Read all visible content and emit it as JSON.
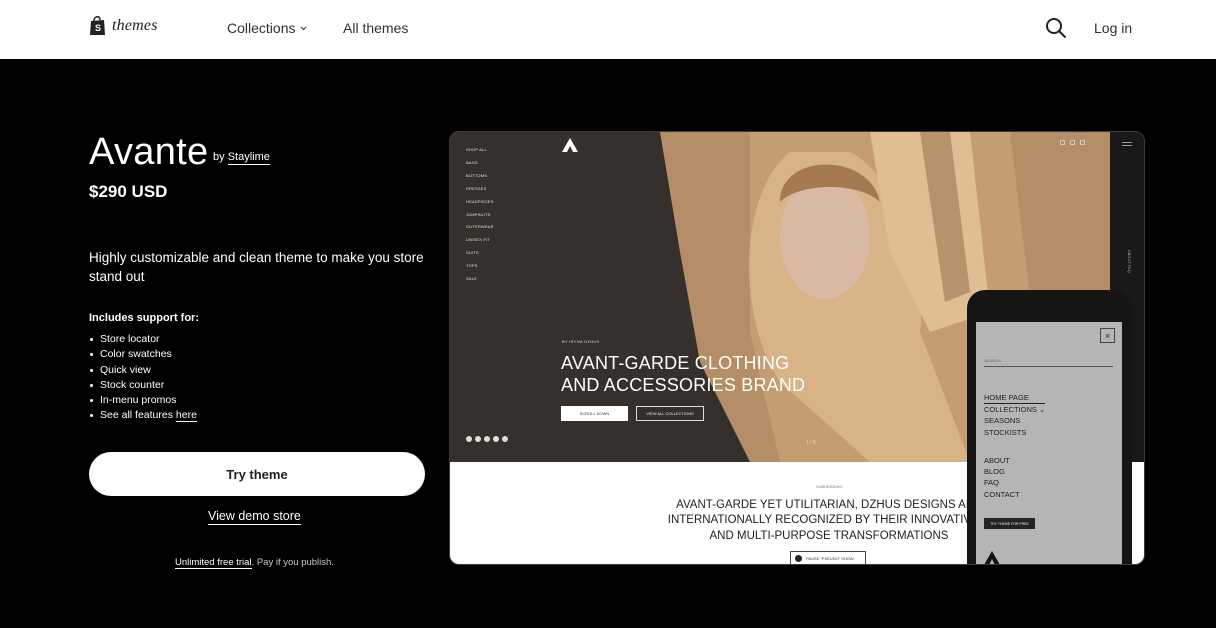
{
  "nav": {
    "logo_text": "themes",
    "collections_label": "Collections",
    "all_themes_label": "All themes",
    "login_label": "Log in"
  },
  "theme": {
    "name": "Avante",
    "by_prefix": "by",
    "author": "Staylime",
    "price": "$290 USD",
    "tagline": "Highly customizable and clean theme to make you store stand out",
    "support_heading": "Includes support for:",
    "features": [
      "Store locator",
      "Color swatches",
      "Quick view",
      "Stock counter",
      "In-menu promos"
    ],
    "features_last_prefix": "See all features",
    "features_last_link": "here",
    "try_button": "Try theme",
    "demo_link": "View demo store",
    "trial_link": "Unlimited free trial",
    "trial_rest": ". Pay if you publish."
  },
  "preview": {
    "menu": [
      "SHOP ALL",
      "BAGS",
      "BOTTOMS",
      "DRESSES",
      "HEADPIECES",
      "JUMPSUITS",
      "OUTERWEAR",
      "UNISEX FIT",
      "SUITS",
      "TOPS",
      "SALE"
    ],
    "kicker": "BY IRYNA DZHUS",
    "hero_title": "AVANT-GARDE CLOTHING AND ACCESSORIES BRAND",
    "btn_scroll": "SCROLL DOWN",
    "btn_collections": "VIEW ALL COLLECTIONS",
    "slide_counter": "1 / 5",
    "rail_text": "ABOUT FAQ",
    "sub_kicker": "SUBHEADING",
    "sub_text": "AVANT-GARDE YET UTILITARIAN, DZHUS DESIGNS ARE\nINTERNATIONALLY RECOGNIZED BY THEIR INNOVATIVE C\nAND MULTI-PURPOSE TRANSFORMATIONS",
    "play_label": "PAUSE \"PSEUDO\" SHOW",
    "phone": {
      "close": "×",
      "search_placeholder": "SEARCH",
      "menu_home": "HOME PAGE",
      "menu_collections": "COLLECTIONS ⌄",
      "menu_seasons": "SEASONS",
      "menu_stockists": "STOCKISTS",
      "menu_about": "ABOUT",
      "menu_blog": "BLOG",
      "menu_faq": "FAQ",
      "menu_contact": "CONTACT",
      "try_btn": "TRY THEME FOR FREE"
    }
  },
  "colors": {
    "page_bg": "#000000",
    "topbar_bg": "#ffffff",
    "hero_bg": "#35302b"
  }
}
